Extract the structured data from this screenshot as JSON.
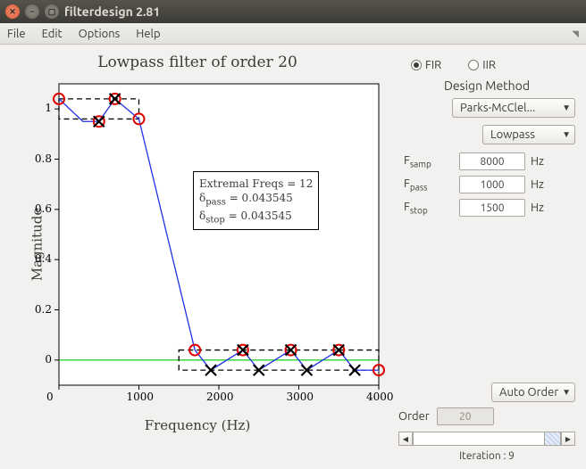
{
  "window": {
    "title": "filterdesign 2.81"
  },
  "menu": {
    "file": "File",
    "edit": "Edit",
    "options": "Options",
    "help": "Help"
  },
  "chart_data": {
    "type": "line",
    "title": "Lowpass filter of order 20",
    "xlabel": "Frequency (Hz)",
    "ylabel": "Magnitude",
    "xlim": [
      0,
      4000
    ],
    "ylim": [
      -0.1,
      1.1
    ],
    "xticks": [
      0,
      1000,
      2000,
      3000,
      4000
    ],
    "yticks": [
      0,
      0.2,
      0.4,
      0.6,
      0.8,
      1
    ],
    "points": {
      "x": [
        0,
        300,
        500,
        700,
        1000,
        1700,
        1900,
        2300,
        2500,
        2900,
        3100,
        3500,
        3700,
        4000
      ],
      "y": [
        1.04,
        0.95,
        0.95,
        1.04,
        0.96,
        0.04,
        -0.04,
        0.04,
        -0.04,
        0.04,
        -0.04,
        0.04,
        -0.04,
        -0.04
      ]
    },
    "circles": {
      "x": [
        0,
        500,
        700,
        1000,
        1700,
        2300,
        2900,
        3500,
        4000
      ],
      "y": [
        1.04,
        0.95,
        1.04,
        0.96,
        0.04,
        0.04,
        0.04,
        0.04,
        -0.04
      ]
    },
    "crosses": {
      "x": [
        500,
        700,
        1900,
        2300,
        2500,
        2900,
        3100,
        3500,
        3700
      ],
      "y": [
        0.95,
        1.04,
        -0.04,
        0.04,
        -0.04,
        0.04,
        -0.04,
        0.04,
        -0.04
      ]
    },
    "passband_box": {
      "x0": 0,
      "x1": 1000,
      "y0": 0.96,
      "y1": 1.04
    },
    "stopband_box": {
      "x0": 1500,
      "x1": 4000,
      "y0": -0.04,
      "y1": 0.04
    },
    "zero_line_y": 0,
    "info": {
      "line1": "Extremal Freqs = 12",
      "delta_pass_label": "δ",
      "delta_pass_sub": "pass",
      "delta_pass_val": " = 0.043545",
      "delta_stop_sub": "stop",
      "delta_stop_val": " = 0.043545"
    }
  },
  "controls": {
    "fir_label": "FIR",
    "iir_label": "IIR",
    "type_selected": "FIR",
    "design_method_head": "Design Method",
    "design_method_value": "Parks-McClel...",
    "shape_value": "Lowpass",
    "fsamp_label_prefix": "F",
    "fsamp_sub": "samp",
    "fpass_sub": "pass",
    "fstop_sub": "stop",
    "hz": "Hz",
    "fsamp": "8000",
    "fpass": "1000",
    "fstop": "1500",
    "order_mode": "Auto Order",
    "order_label": "Order",
    "order_value": "20",
    "iteration_label": "Iteration : 9"
  }
}
